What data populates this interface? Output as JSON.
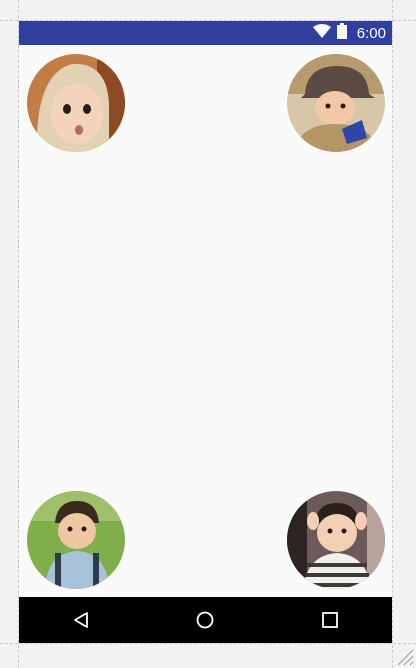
{
  "colors": {
    "status_bar": "#303f9f",
    "nav_bar": "#000000",
    "background": "#fafafa"
  },
  "status_bar": {
    "time": "6:00",
    "icons": [
      "wifi-icon",
      "battery-icon"
    ]
  },
  "avatars": [
    {
      "name": "avatar-top-left",
      "description_icon": "child-photo"
    },
    {
      "name": "avatar-top-right",
      "description_icon": "child-photo"
    },
    {
      "name": "avatar-bottom-left",
      "description_icon": "child-photo"
    },
    {
      "name": "avatar-bottom-right",
      "description_icon": "child-photo"
    }
  ],
  "nav_bar": {
    "buttons": [
      "back-icon",
      "home-icon",
      "recents-icon"
    ]
  }
}
